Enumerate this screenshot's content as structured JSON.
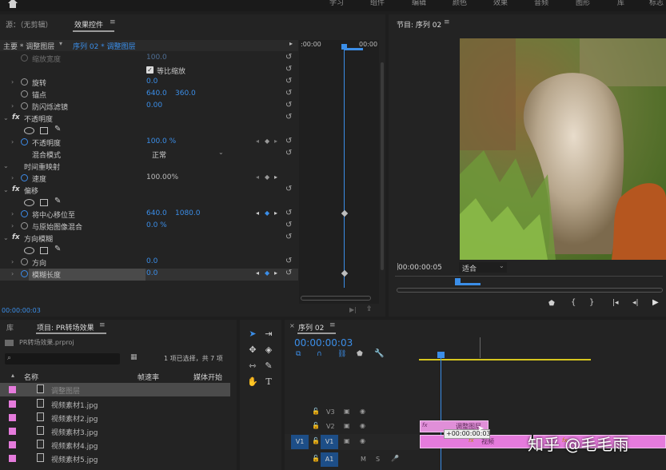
{
  "topbar": {
    "workspaces": [
      "学习",
      "组件",
      "编辑",
      "颜色",
      "效果",
      "音频",
      "图形",
      "库",
      "标志"
    ]
  },
  "source_panel": {
    "source_tab": "源：（无剪辑）",
    "effect_controls_tab": "效果控件",
    "master_label": "主要 * 调整图层",
    "sequence_clip": "序列 02 * 调整图层",
    "time_start": ":00:00",
    "time_end": "00:00",
    "timecode": "00:00:00:03",
    "rows": [
      {
        "label": "缩放宽度",
        "value": "100.0"
      },
      {
        "label": "等比缩放"
      },
      {
        "label": "旋转",
        "value": "0.0"
      },
      {
        "label": "锚点",
        "value": "640.0",
        "value2": "360.0"
      },
      {
        "label": "防闪烁滤镜",
        "value": "0.00"
      },
      {
        "label": "不透明度"
      },
      {
        "label": "不透明度",
        "value": "100.0 %"
      },
      {
        "label": "混合模式",
        "value": "正常"
      },
      {
        "label": "时间重映射"
      },
      {
        "label": "速度",
        "value": "100.00%"
      },
      {
        "label": "偏移"
      },
      {
        "label": "将中心移位至",
        "value": "640.0",
        "value2": "1080.0"
      },
      {
        "label": "与原始图像混合",
        "value": "0.0 %"
      },
      {
        "label": "方向模糊"
      },
      {
        "label": "方向",
        "value": "0.0"
      },
      {
        "label": "模糊长度",
        "value": "0.0"
      }
    ]
  },
  "program_monitor": {
    "title": "节目: 序列 02",
    "timecode": "00:00:00:05",
    "fit": "适合"
  },
  "project_panel": {
    "library_tab": "库",
    "project_tab": "项目: PR转场效果",
    "file_name": "PR转场效果.prproj",
    "selection_info": "1 项已选择，共 7 项",
    "columns": {
      "name": "名称",
      "frame_rate": "帧速率",
      "media_start": "媒体开始"
    },
    "items": [
      {
        "name": "调整图层",
        "selected": true
      },
      {
        "name": "视频素材1.jpg"
      },
      {
        "name": "视频素材2.jpg"
      },
      {
        "name": "视频素材3.jpg"
      },
      {
        "name": "视频素材4.jpg"
      },
      {
        "name": "视频素材5.jpg"
      }
    ]
  },
  "timeline": {
    "title": "序列 02",
    "timecode": "00:00:00:03",
    "tracks": {
      "v3": "V3",
      "v2": "V2",
      "v1_src": "V1",
      "v1": "V1",
      "a1": "A1",
      "m": "M",
      "s": "S"
    },
    "clip_label_adj": "调整图层",
    "clip_label_video": "视频",
    "tooltip": "+00:00:00:03",
    "fx_badge": "fx"
  },
  "watermark": "知乎 @毛毛雨",
  "colors": {
    "accent_blue": "#3b8ee8",
    "clip_pink": "#e57bdc",
    "in_out_yellow": "#d6c61e"
  }
}
